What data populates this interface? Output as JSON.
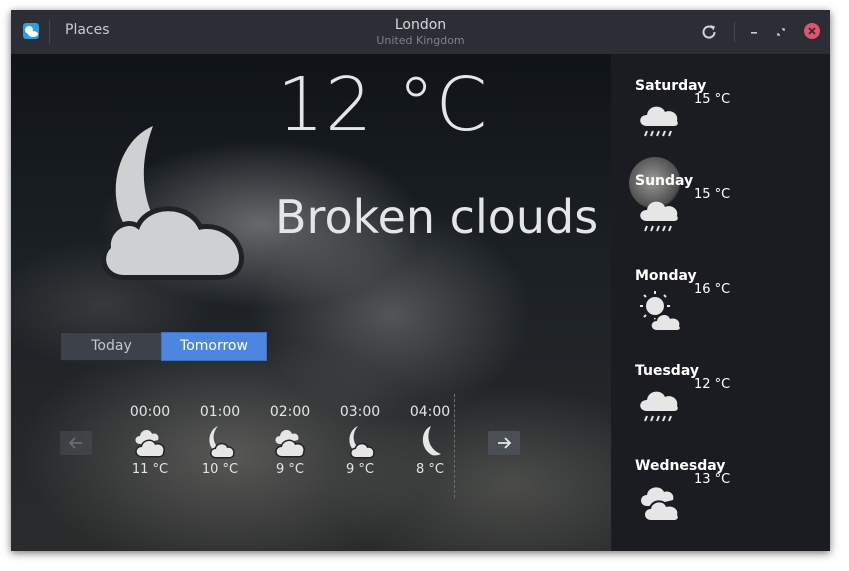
{
  "titlebar": {
    "places_label": "Places",
    "city": "London",
    "country": "United Kingdom"
  },
  "icons": {
    "app": "weather-app-icon",
    "refresh": "refresh-icon",
    "minimize": "minimize-icon",
    "maximize": "maximize-icon",
    "close": "close-icon"
  },
  "current": {
    "temperature": "12 °C",
    "description": "Broken clouds",
    "icon": "moon-cloud-icon"
  },
  "tabs": {
    "today": "Today",
    "tomorrow": "Tomorrow",
    "selected": "Tomorrow"
  },
  "hourly": [
    {
      "time": "00:00",
      "temp": "11 °C",
      "icon": "clouds-icon"
    },
    {
      "time": "01:00",
      "temp": "10 °C",
      "icon": "moon-cloud-icon"
    },
    {
      "time": "02:00",
      "temp": "9 °C",
      "icon": "clouds-icon"
    },
    {
      "time": "03:00",
      "temp": "9 °C",
      "icon": "moon-cloud-icon"
    },
    {
      "time": "04:00",
      "temp": "8 °C",
      "icon": "moon-icon"
    }
  ],
  "forecast": [
    {
      "day": "Saturday",
      "temp": "15 °C",
      "icon": "rain-icon"
    },
    {
      "day": "Sunday",
      "temp": "15 °C",
      "icon": "rain-icon"
    },
    {
      "day": "Monday",
      "temp": "16 °C",
      "icon": "sun-cloud-icon"
    },
    {
      "day": "Tuesday",
      "temp": "12 °C",
      "icon": "rain-icon"
    },
    {
      "day": "Wednesday",
      "temp": "13 °C",
      "icon": "clouds-icon"
    }
  ],
  "colors": {
    "accent": "#4d86e0",
    "titlebar": "#2b2e34",
    "close": "#e0546f"
  }
}
